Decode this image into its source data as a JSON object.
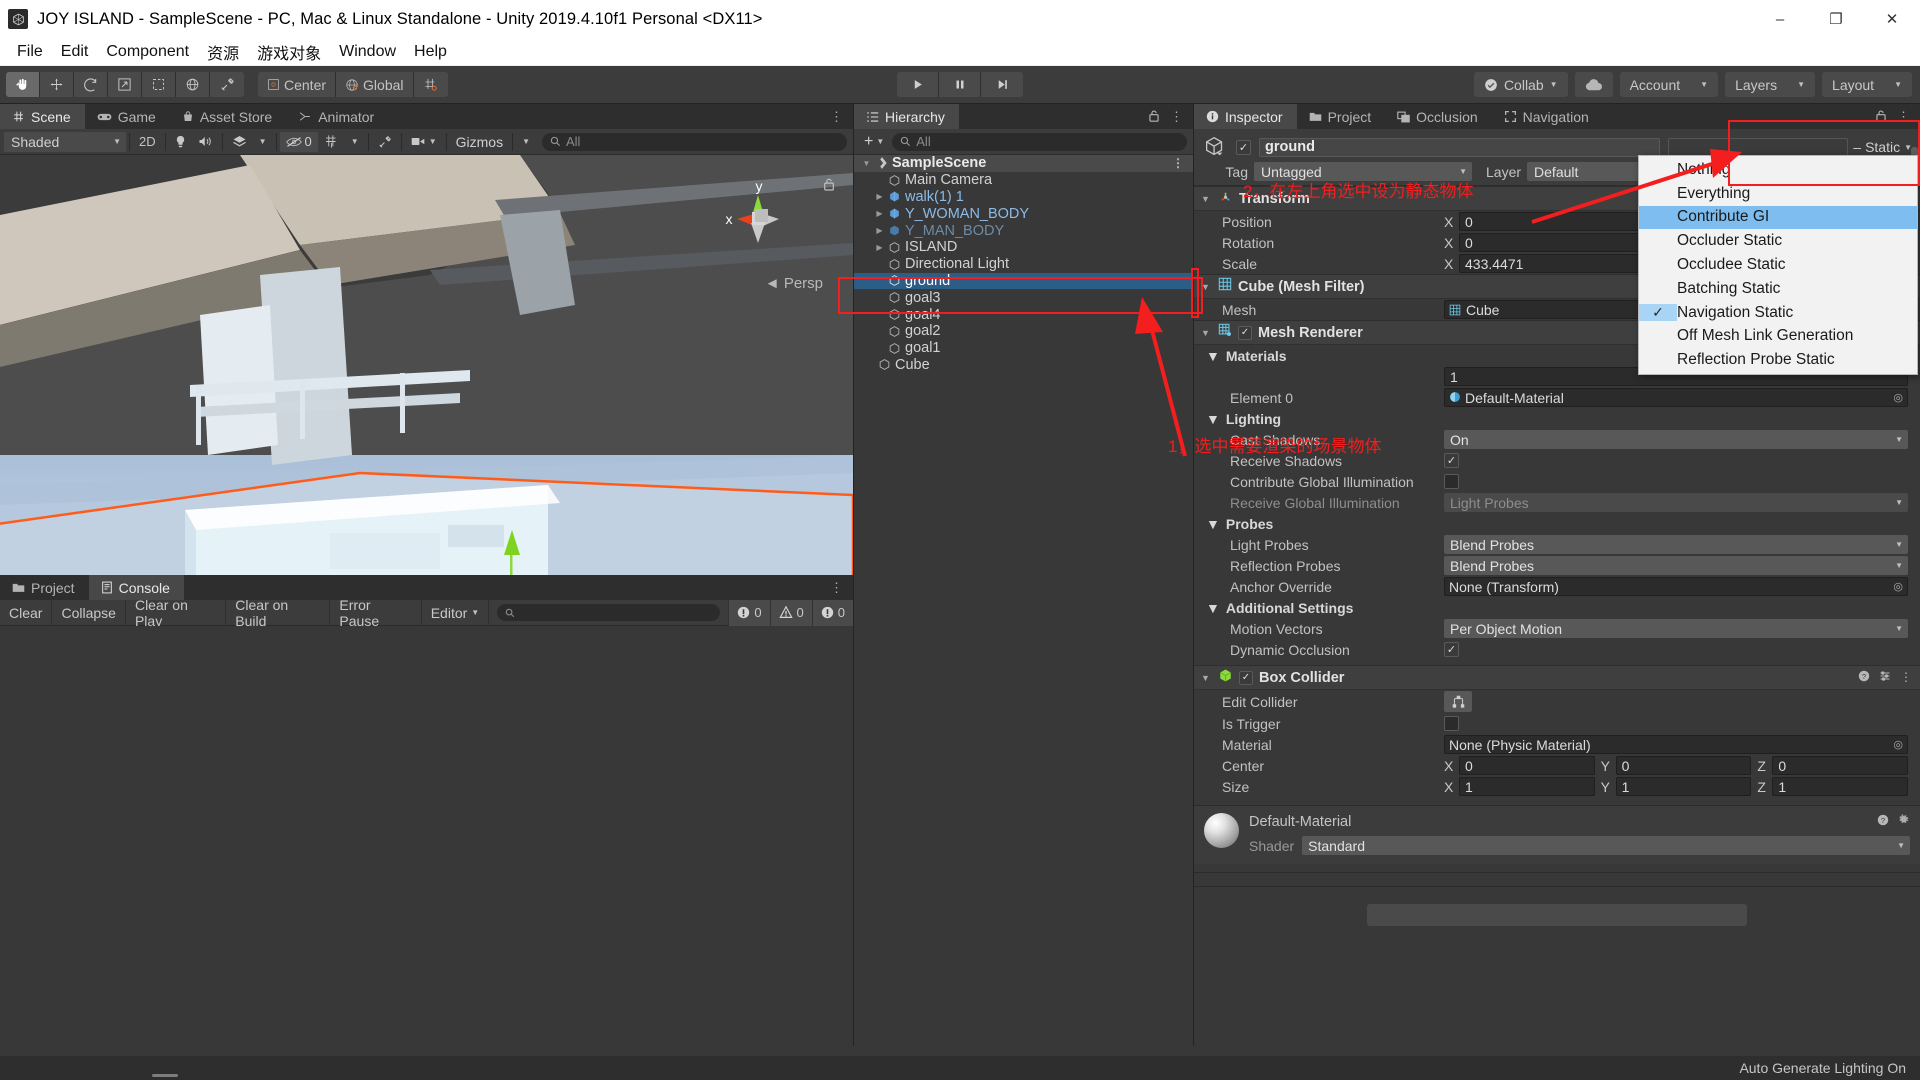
{
  "window": {
    "title": "JOY ISLAND - SampleScene - PC, Mac & Linux Standalone - Unity 2019.4.10f1 Personal <DX11>",
    "app_icon": "unity-icon",
    "minimize": "–",
    "maximize": "❐",
    "close": "✕"
  },
  "menubar": {
    "items": [
      "File",
      "Edit",
      "Component",
      "资源",
      "游戏对象",
      "Window",
      "Help"
    ]
  },
  "toolbar": {
    "tools": [
      {
        "name": "hand-tool",
        "glyph": "✋",
        "active": true
      },
      {
        "name": "move-tool",
        "glyph": "✥",
        "active": false
      },
      {
        "name": "rotate-tool",
        "glyph": "↻",
        "active": false
      },
      {
        "name": "scale-tool",
        "glyph": "↗",
        "active": false
      },
      {
        "name": "rect-tool",
        "glyph": "⬚",
        "active": false
      },
      {
        "name": "transform-tool",
        "glyph": "⊕",
        "active": false
      },
      {
        "name": "custom-tool",
        "glyph": "⚒",
        "active": false
      }
    ],
    "pivot_label": "Center",
    "handle_label": "Global",
    "grid_snap": "grid-snap-icon",
    "play": "▶",
    "pause": "❙❙",
    "step": "▶❙",
    "collab_label": "Collab",
    "cloud_icon": "cloud-icon",
    "account_label": "Account",
    "layers_label": "Layers",
    "layout_label": "Layout"
  },
  "scene_panel": {
    "tabs": [
      {
        "label": "Scene",
        "icon": "grid-icon",
        "selected": true
      },
      {
        "label": "Game",
        "icon": "gamepad-icon",
        "selected": false
      },
      {
        "label": "Asset Store",
        "icon": "store-icon",
        "selected": false
      },
      {
        "label": "Animator",
        "icon": "animator-icon",
        "selected": false
      }
    ],
    "draw_mode": "Shaded",
    "mode_2d": "2D",
    "lighting_icon": "light-bulb-icon",
    "audio_icon": "audio-icon",
    "fx_icon": "effects-icon",
    "hidden_count": "0",
    "visibility_icon": "eye-off-icon",
    "scene_vis_icon": "scene-visibility-icon",
    "component_tools_icon": "component-tools-icon",
    "camera_icon": "camera-icon",
    "gizmos_label": "Gizmos",
    "search_placeholder": "All",
    "perspective_label": "Persp",
    "gizmo_axes": {
      "x": "x",
      "y": "y"
    }
  },
  "hierarchy": {
    "title": "Hierarchy",
    "add_label": "+",
    "search_placeholder": "All",
    "lock_icon": "lock-icon",
    "kebab_icon": "kebab-icon",
    "items": [
      {
        "label": "SampleScene",
        "type": "scene",
        "depth": 0,
        "twisty": "open",
        "icon": "unity-scene-icon"
      },
      {
        "label": "Main Camera",
        "type": "object",
        "depth": 1,
        "twisty": "none",
        "icon": "gameobject-icon"
      },
      {
        "label": "walk(1) 1",
        "type": "prefab",
        "depth": 1,
        "twisty": "closed",
        "icon": "prefab-icon"
      },
      {
        "label": "Y_WOMAN_BODY",
        "type": "prefab",
        "depth": 1,
        "twisty": "closed",
        "icon": "prefab-icon"
      },
      {
        "label": "Y_MAN_BODY",
        "type": "prefab-dim",
        "depth": 1,
        "twisty": "closed",
        "icon": "prefab-icon"
      },
      {
        "label": "ISLAND",
        "type": "object",
        "depth": 1,
        "twisty": "closed",
        "icon": "gameobject-icon"
      },
      {
        "label": "Directional Light",
        "type": "object",
        "depth": 1,
        "twisty": "none",
        "icon": "gameobject-icon"
      },
      {
        "label": "ground",
        "type": "object",
        "depth": 1,
        "twisty": "none",
        "icon": "gameobject-icon",
        "selected": true
      },
      {
        "label": "goal3",
        "type": "object",
        "depth": 1,
        "twisty": "none",
        "icon": "gameobject-icon"
      },
      {
        "label": "goal4",
        "type": "object",
        "depth": 1,
        "twisty": "none",
        "icon": "gameobject-icon"
      },
      {
        "label": "goal2",
        "type": "object",
        "depth": 1,
        "twisty": "none",
        "icon": "gameobject-icon"
      },
      {
        "label": "goal1",
        "type": "object",
        "depth": 1,
        "twisty": "none",
        "icon": "gameobject-icon"
      },
      {
        "label": "Cube",
        "type": "object",
        "depth": 1,
        "twisty": "none",
        "icon": "gameobject-icon"
      }
    ]
  },
  "inspector": {
    "tabs": [
      {
        "label": "Inspector",
        "icon": "info-icon",
        "selected": true
      },
      {
        "label": "Project",
        "icon": "folder-icon",
        "selected": false
      },
      {
        "label": "Occlusion",
        "icon": "occlusion-icon",
        "selected": false
      },
      {
        "label": "Navigation",
        "icon": "navigation-icon",
        "selected": false
      }
    ],
    "lock_icon": "lock-icon",
    "kebab_icon": "kebab-icon",
    "object_name": "ground",
    "enabled": true,
    "tag_label": "Tag",
    "tag_value": "Untagged",
    "layer_label": "Layer",
    "layer_value": "Default",
    "static_label": "Static",
    "static_checked": false
  },
  "static_dropdown": {
    "items": [
      {
        "label": "Nothing",
        "checked": false,
        "highlighted": false
      },
      {
        "label": "Everything",
        "checked": false,
        "highlighted": false
      },
      {
        "label": "Contribute GI",
        "checked": false,
        "highlighted": true
      },
      {
        "label": "Occluder Static",
        "checked": false,
        "highlighted": false
      },
      {
        "label": "Occludee Static",
        "checked": false,
        "highlighted": false
      },
      {
        "label": "Batching Static",
        "checked": false,
        "highlighted": false
      },
      {
        "label": "Navigation Static",
        "checked": true,
        "highlighted": false
      },
      {
        "label": "Off Mesh Link Generation",
        "checked": false,
        "highlighted": false
      },
      {
        "label": "Reflection Probe Static",
        "checked": false,
        "highlighted": false
      }
    ],
    "check_glyph": "✓"
  },
  "components": {
    "transform": {
      "title": "Transform",
      "icon": "transform-icon",
      "rows": [
        {
          "name": "Position",
          "x": "0",
          "y": "",
          "z": ""
        },
        {
          "name": "Rotation",
          "x": "0",
          "y": "",
          "z": ""
        },
        {
          "name": "Scale",
          "x": "433.4471",
          "y": "",
          "z": ""
        }
      ],
      "axis_labels": [
        "X",
        "Y",
        "Z"
      ]
    },
    "mesh_filter": {
      "title": "Cube (Mesh Filter)",
      "icon": "mesh-filter-icon",
      "mesh_label": "Mesh",
      "mesh_value": "Cube"
    },
    "mesh_renderer": {
      "title": "Mesh Renderer",
      "icon": "mesh-renderer-icon",
      "enabled": true,
      "help_icon": "help-icon",
      "preset_icon": "preset-icon",
      "kebab_icon": "kebab-icon",
      "sections": [
        {
          "name": "Materials",
          "rows": [
            {
              "label": "",
              "type": "count",
              "value": "1"
            },
            {
              "label": "Element 0",
              "type": "object",
              "value": "Default-Material",
              "swatch": "material-swatch-icon"
            }
          ]
        },
        {
          "name": "Lighting",
          "rows": [
            {
              "label": "Cast Shadows",
              "type": "dropdown",
              "value": "On"
            },
            {
              "label": "Receive Shadows",
              "type": "checkbox",
              "value": true
            },
            {
              "label": "Contribute Global Illumination",
              "type": "checkbox",
              "value": false
            },
            {
              "label": "Receive Global Illumination",
              "type": "dropdown",
              "value": "Light Probes",
              "disabled": true
            }
          ]
        },
        {
          "name": "Probes",
          "rows": [
            {
              "label": "Light Probes",
              "type": "dropdown",
              "value": "Blend Probes"
            },
            {
              "label": "Reflection Probes",
              "type": "dropdown",
              "value": "Blend Probes"
            },
            {
              "label": "Anchor Override",
              "type": "object",
              "value": "None (Transform)"
            }
          ]
        },
        {
          "name": "Additional Settings",
          "rows": [
            {
              "label": "Motion Vectors",
              "type": "dropdown",
              "value": "Per Object Motion"
            },
            {
              "label": "Dynamic Occlusion",
              "type": "checkbox",
              "value": true
            }
          ]
        }
      ]
    },
    "box_collider": {
      "title": "Box Collider",
      "icon": "box-collider-icon",
      "enabled": true,
      "edit_collider_label": "Edit Collider",
      "edit_collider_icon": "edit-collider-icon",
      "is_trigger_label": "Is Trigger",
      "is_trigger_value": false,
      "material_label": "Material",
      "material_value": "None (Physic Material)",
      "center_label": "Center",
      "center": {
        "x": "0",
        "y": "0",
        "z": "0"
      },
      "size_label": "Size",
      "size": {
        "x": "1",
        "y": "1",
        "z": "1"
      }
    },
    "material_preview": {
      "name": "Default-Material",
      "shader_label": "Shader",
      "shader_value": "Standard",
      "help_icon": "help-icon",
      "gear_icon": "gear-icon"
    }
  },
  "console": {
    "tabs": [
      {
        "label": "Project",
        "icon": "folder-icon",
        "selected": false
      },
      {
        "label": "Console",
        "icon": "console-icon",
        "selected": true
      }
    ],
    "buttons": [
      "Clear",
      "Collapse",
      "Clear on Play",
      "Clear on Build",
      "Error Pause"
    ],
    "editor_label": "Editor",
    "search_placeholder": "",
    "badges": [
      {
        "icon": "log-icon",
        "count": "0"
      },
      {
        "icon": "warn-icon",
        "count": "0"
      },
      {
        "icon": "error-icon",
        "count": "0"
      }
    ],
    "kebab_icon": "kebab-icon"
  },
  "annotations": [
    {
      "id": "anno-1",
      "text": "1，选中需要渲染的场景物体",
      "color": "#f41e1e"
    },
    {
      "id": "anno-2",
      "text": "2，在左上角选中设为静态物体",
      "color": "#f41e1e"
    }
  ],
  "statusbar": {
    "text": "Auto Generate Lighting On"
  },
  "colors": {
    "accent_selection": "#2c5d87",
    "annotation_red": "#f41e1e",
    "menu_highlight": "#7ebdf0",
    "prefab_blue": "#8bbbe8"
  }
}
